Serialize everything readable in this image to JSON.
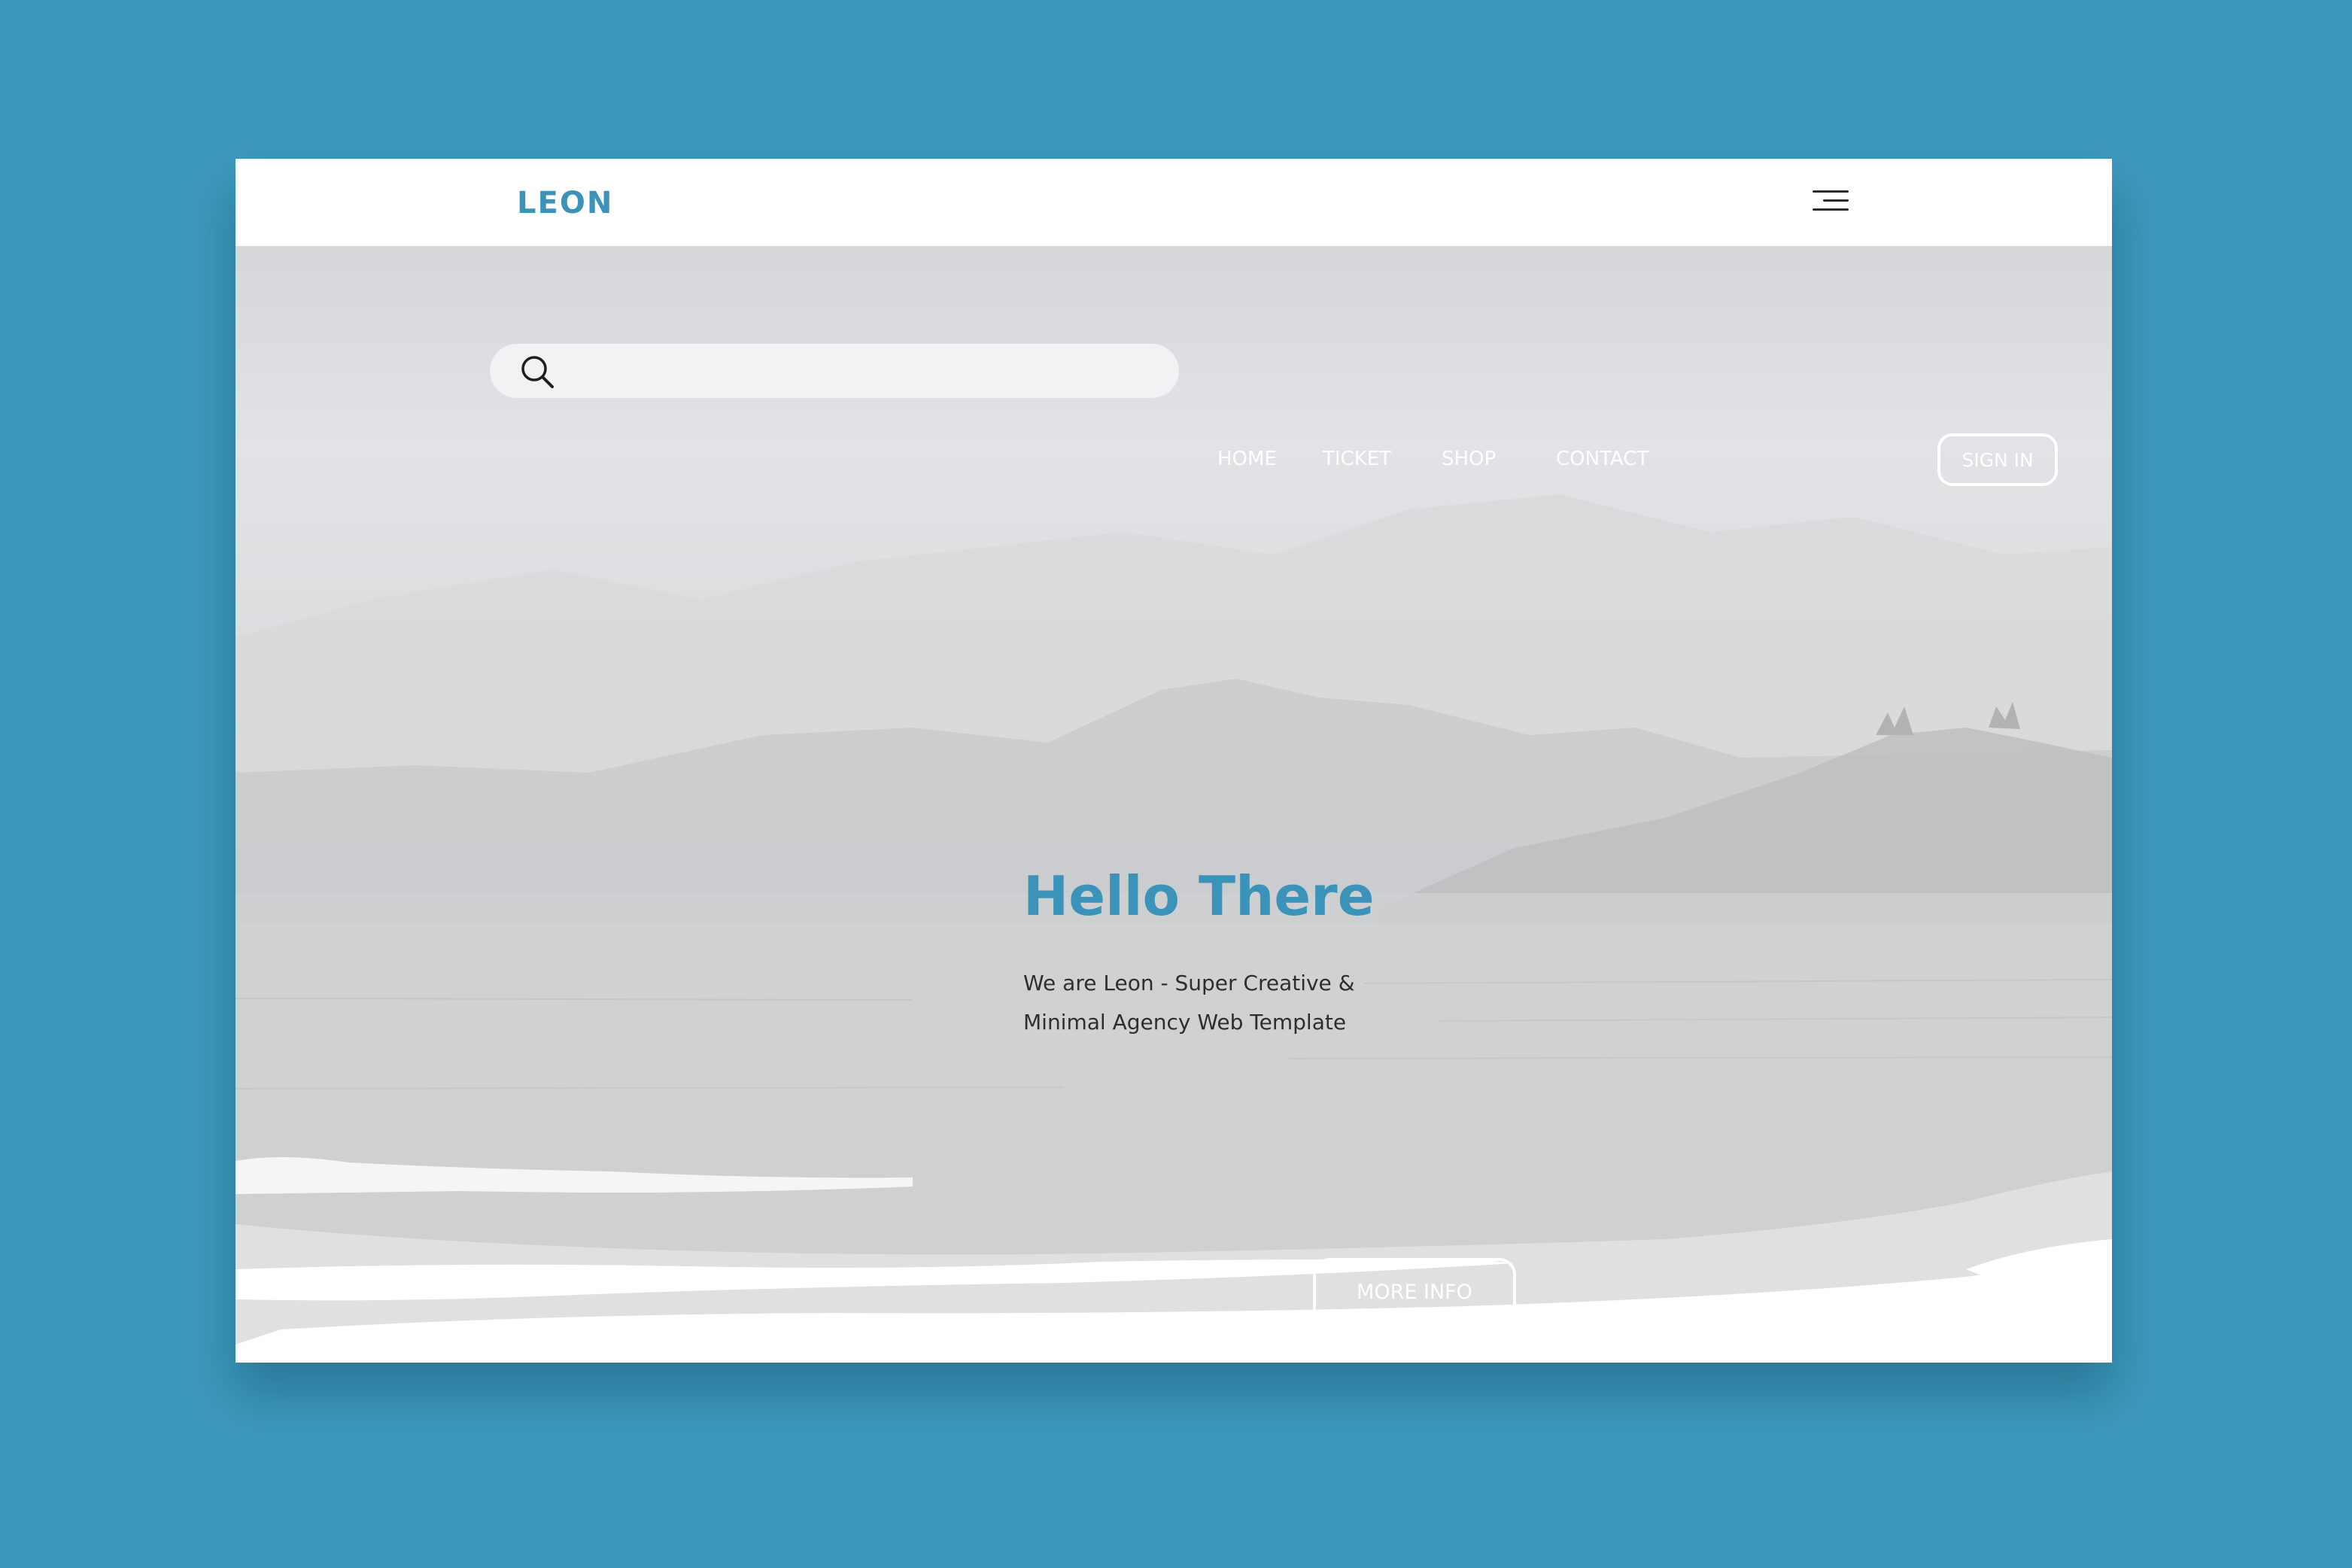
{
  "brand": {
    "logo_text": "LEON"
  },
  "header": {
    "menu_icon": "hamburger-menu-icon"
  },
  "search": {
    "icon": "search-icon",
    "placeholder": ""
  },
  "nav": {
    "items": [
      {
        "label": "HOME"
      },
      {
        "label": "TICKET"
      },
      {
        "label": "SHOP"
      },
      {
        "label": "CONTACT"
      }
    ],
    "signin_label": "SIGN IN"
  },
  "hero": {
    "title": "Hello There",
    "subtitle_line1": "We are Leon - Super Creative &",
    "subtitle_line2": "Minimal Agency Web Template",
    "cta_label": "MORE INFO"
  },
  "colors": {
    "background": "#3c98bb",
    "accent": "#3b93b9",
    "hero_overlay": "#d6d7da",
    "card": "#ffffff"
  }
}
